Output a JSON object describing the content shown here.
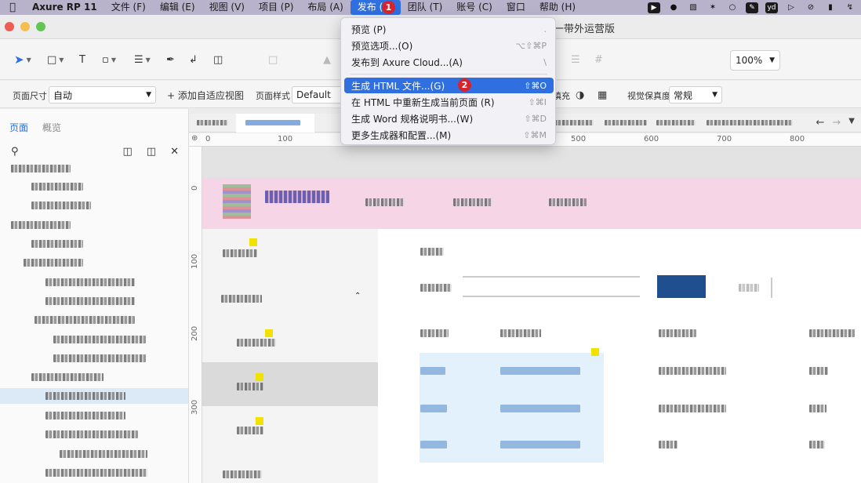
{
  "menubar": {
    "app": "Axure RP 11",
    "items": [
      "文件 (F)",
      "编辑 (E)",
      "视图 (V)",
      "项目 (P)",
      "布局 (A)",
      "发布 (U)",
      "团队 (T)",
      "账号 (C)",
      "窗口",
      "帮助 (H)"
    ],
    "tray": [
      "yd"
    ]
  },
  "window": {
    "title": "一带外运营版"
  },
  "toolbar": {
    "zoom": "100%"
  },
  "propbar": {
    "page_size_label": "页面尺寸",
    "page_size_value": "自动",
    "add_view": "+ 添加自适应视图",
    "page_style_label": "页面样式",
    "page_style_value": "Default",
    "fill_label": "填充",
    "fidelity_label": "视觉保真度",
    "fidelity_value": "常规"
  },
  "left_panel": {
    "tabs": [
      "页面",
      "概览"
    ]
  },
  "rulers": {
    "h": [
      "0",
      "100",
      "500",
      "600",
      "700",
      "800"
    ],
    "v": [
      "0",
      "100",
      "200",
      "300"
    ]
  },
  "publish_menu": {
    "items": [
      {
        "label": "预览 (P)",
        "shortcut": "."
      },
      {
        "label": "预览选项...(O)",
        "shortcut": "⌥⇧⌘P"
      },
      {
        "label": "发布到 Axure Cloud...(A)",
        "shortcut": "\\"
      },
      {
        "label": "生成 HTML 文件...(G)",
        "shortcut": "⇧⌘O"
      },
      {
        "label": "在 HTML 中重新生成当前页面 (R)",
        "shortcut": "⇧⌘I"
      },
      {
        "label": "生成 Word 规格说明书...(W)",
        "shortcut": "⇧⌘D"
      },
      {
        "label": "更多生成器和配置...(M)",
        "shortcut": "⇧⌘M"
      }
    ],
    "step_badges": [
      "1",
      "2"
    ]
  }
}
